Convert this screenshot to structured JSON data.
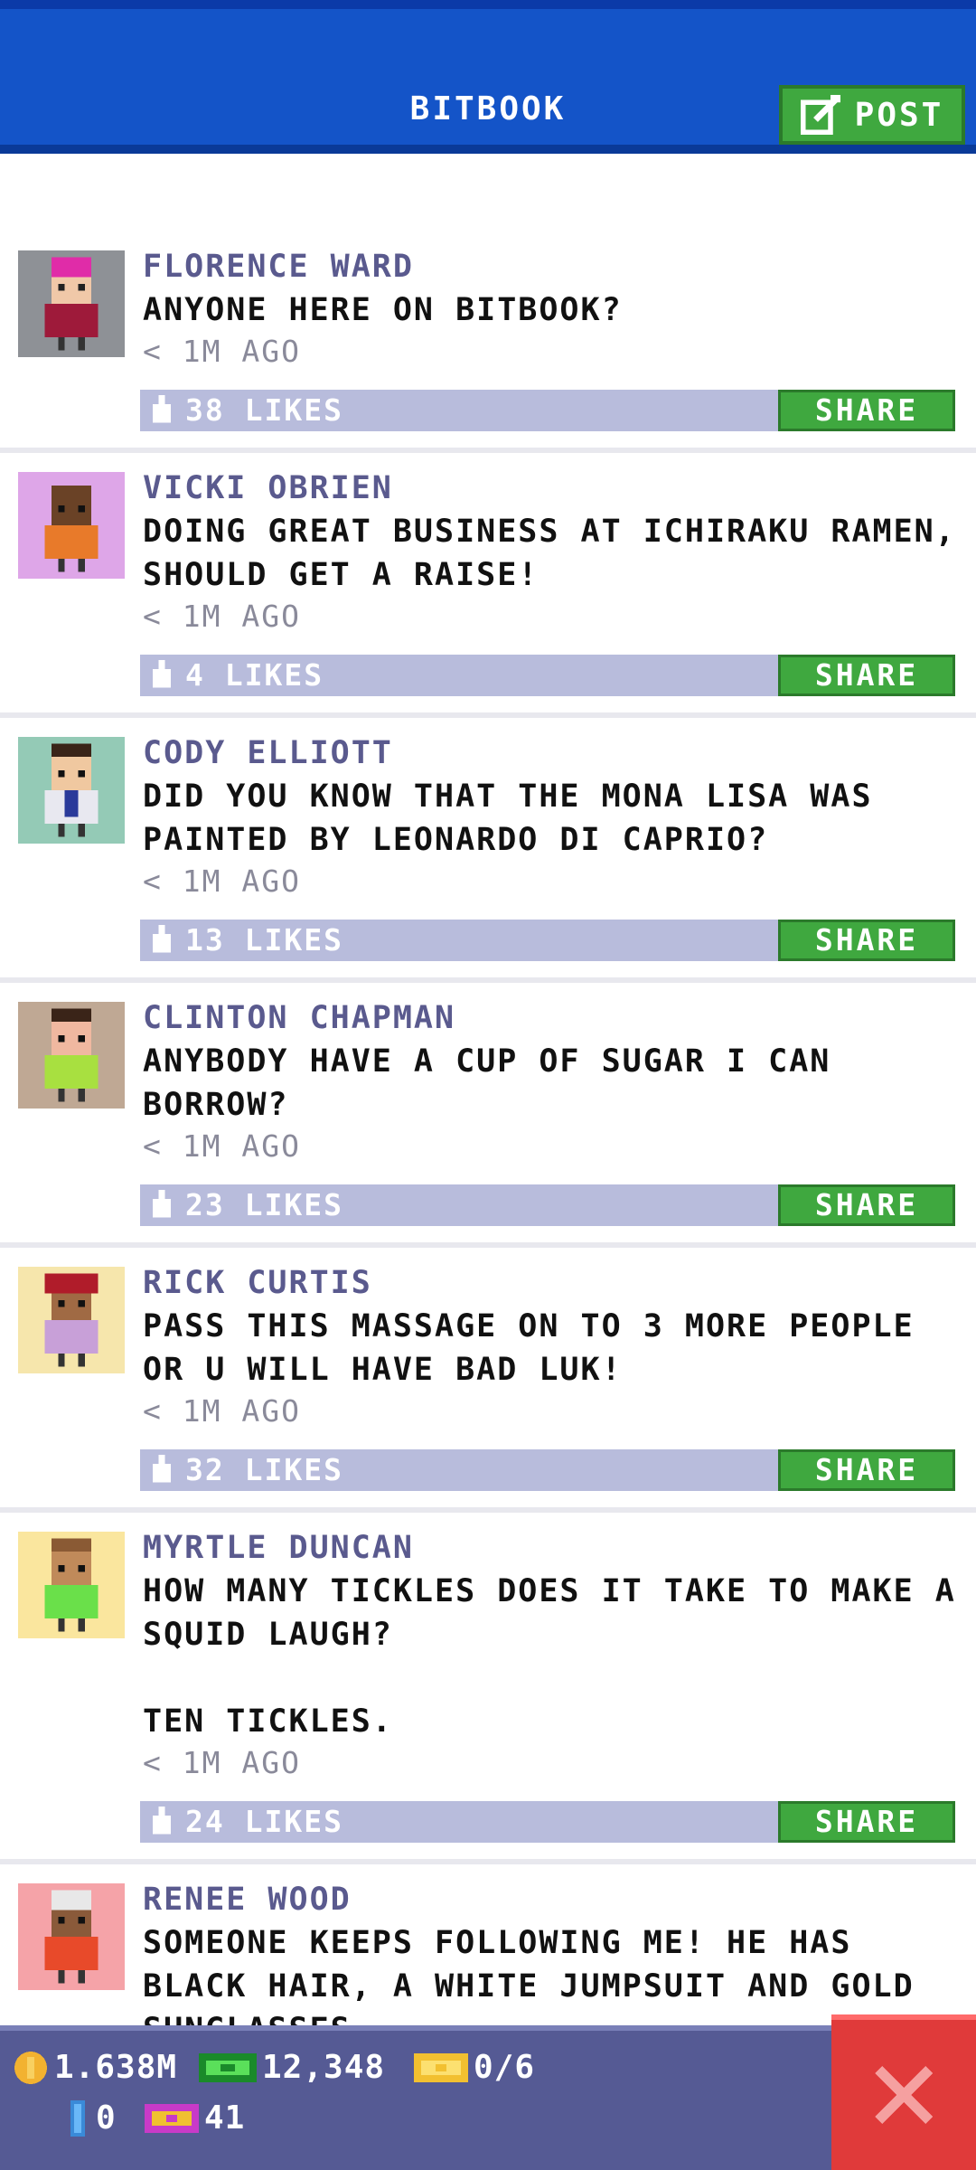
{
  "header": {
    "title": "BITBOOK",
    "post_label": "POST"
  },
  "feed": {
    "share_label": "SHARE",
    "posts": [
      {
        "author": "FLORENCE WARD",
        "message": "ANYONE HERE ON BITBOOK?",
        "time": "< 1M AGO",
        "likes": "38 LIKES",
        "avatar_bg": "#8e9196"
      },
      {
        "author": "VICKI OBRIEN",
        "message": "DOING GREAT BUSINESS AT ICHIRAKU RAMEN,\nSHOULD GET A RAISE!",
        "time": "< 1M AGO",
        "likes": "4 LIKES",
        "avatar_bg": "#dea6e8"
      },
      {
        "author": "CODY ELLIOTT",
        "message": "DID YOU KNOW THAT THE MONA LISA WAS\nPAINTED BY LEONARDO DI CAPRIO?",
        "time": "< 1M AGO",
        "likes": "13 LIKES",
        "avatar_bg": "#94cab6"
      },
      {
        "author": "CLINTON CHAPMAN",
        "message": "ANYBODY HAVE A CUP OF SUGAR I CAN\nBORROW?",
        "time": "< 1M AGO",
        "likes": "23 LIKES",
        "avatar_bg": "#bfa894"
      },
      {
        "author": "RICK CURTIS",
        "message": "PASS THIS MASSAGE ON TO 3 MORE PEOPLE\nOR U WILL HAVE BAD LUK!",
        "time": "< 1M AGO",
        "likes": "32 LIKES",
        "avatar_bg": "#f6e6ac"
      },
      {
        "author": "MYRTLE DUNCAN",
        "message": "HOW MANY TICKLES DOES IT TAKE TO MAKE A\nSQUID LAUGH?\n\nTEN TICKLES.",
        "time": "< 1M AGO",
        "likes": "24 LIKES",
        "avatar_bg": "#fae69e"
      },
      {
        "author": "RENEE WOOD",
        "message": "SOMEONE KEEPS FOLLOWING ME! HE HAS\nBLACK HAIR, A WHITE JUMPSUIT AND GOLD\nSUNGLASSES",
        "time": "",
        "likes": "",
        "avatar_bg": "#f5a3a8"
      }
    ]
  },
  "bottom_bar": {
    "coins": "1.638M",
    "bux": "12,348",
    "tickets": "0/6",
    "keys": "0",
    "vip": "41"
  },
  "colors": {
    "header_blue": "#1454c8",
    "share_green": "#3fa83f",
    "likes_bar": "#b8bcdc",
    "author_purple": "#5a5a8e",
    "close_red": "#e03a3a"
  }
}
